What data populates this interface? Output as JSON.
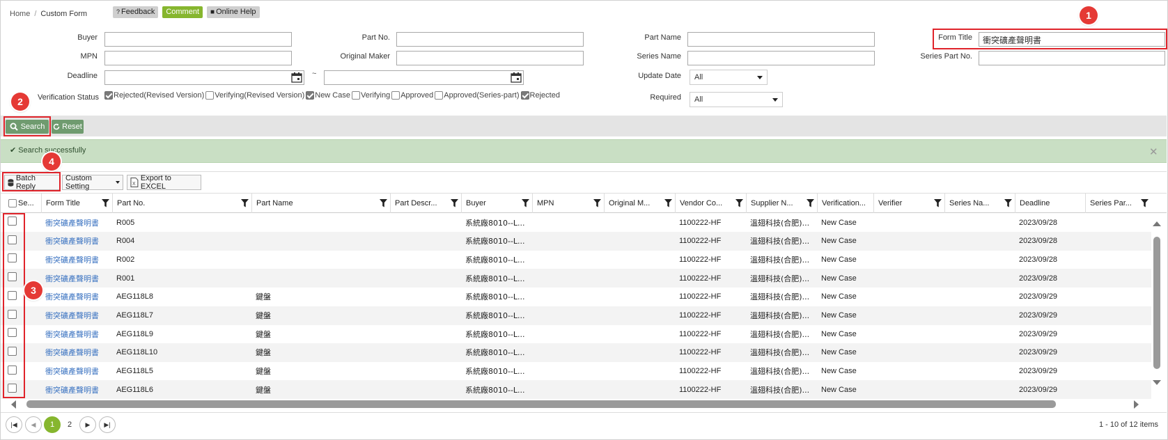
{
  "breadcrumb": {
    "home": "Home",
    "sep": "/",
    "current": "Custom Form"
  },
  "toplinks": {
    "feedback": "Feedback",
    "comment": "Comment",
    "online_help": "Online Help"
  },
  "form": {
    "buyer_label": "Buyer",
    "buyer_value": "",
    "part_no_label": "Part No.",
    "part_no_value": "",
    "part_name_label": "Part Name",
    "part_name_value": "",
    "form_title_label": "Form Title",
    "form_title_value": "衝突礦產聲明書",
    "mpn_label": "MPN",
    "mpn_value": "",
    "original_maker_label": "Original Maker",
    "original_maker_value": "",
    "series_name_label": "Series Name",
    "series_name_value": "",
    "series_part_no_label": "Series Part No.",
    "series_part_no_value": "",
    "deadline_label": "Deadline",
    "deadline_from": "",
    "deadline_to": "",
    "tilde": "~",
    "update_date_label": "Update Date",
    "update_date_value": "All",
    "required_label": "Required",
    "required_value": "All",
    "verification_status_label": "Verification Status",
    "verification_status": [
      {
        "label": "Rejected(Revised Version)",
        "checked": true
      },
      {
        "label": "Verifying(Revised Version)",
        "checked": false
      },
      {
        "label": "New Case",
        "checked": true
      },
      {
        "label": "Verifying",
        "checked": false
      },
      {
        "label": "Approved",
        "checked": false
      },
      {
        "label": "Approved(Series-part)",
        "checked": false
      },
      {
        "label": "Rejected",
        "checked": true
      }
    ]
  },
  "actions": {
    "search": "Search",
    "reset": "Reset"
  },
  "message": {
    "text": "Search successfully"
  },
  "grid_toolbar": {
    "batch_reply": "Batch Reply",
    "custom_setting": "Custom Setting",
    "export": "Export to EXCEL"
  },
  "columns": [
    "Se...",
    "Form Title",
    "Part No.",
    "Part Name",
    "Part Descr...",
    "Buyer",
    "MPN",
    "Original M...",
    "Vendor Co...",
    "Supplier N...",
    "Verification...",
    "Verifier",
    "Series Na...",
    "Deadline",
    "Series Par..."
  ],
  "rows": [
    {
      "form_title": "衝突礦產聲明書",
      "part_no": "R005",
      "part_name": "",
      "buyer": "系統廠8010--L...",
      "vendor_code": "1100222-HF",
      "supplier": "溫翅科技(合肥)...",
      "verification": "New Case",
      "deadline": "2023/09/28"
    },
    {
      "form_title": "衝突礦產聲明書",
      "part_no": "R004",
      "part_name": "",
      "buyer": "系統廠8010--L...",
      "vendor_code": "1100222-HF",
      "supplier": "溫翅科技(合肥)...",
      "verification": "New Case",
      "deadline": "2023/09/28"
    },
    {
      "form_title": "衝突礦產聲明書",
      "part_no": "R002",
      "part_name": "",
      "buyer": "系統廠8010--L...",
      "vendor_code": "1100222-HF",
      "supplier": "溫翅科技(合肥)...",
      "verification": "New Case",
      "deadline": "2023/09/28"
    },
    {
      "form_title": "衝突礦產聲明書",
      "part_no": "R001",
      "part_name": "",
      "buyer": "系統廠8010--L...",
      "vendor_code": "1100222-HF",
      "supplier": "溫翅科技(合肥)...",
      "verification": "New Case",
      "deadline": "2023/09/28"
    },
    {
      "form_title": "衝突礦產聲明書",
      "part_no": "AEG118L8",
      "part_name": "鍵盤",
      "buyer": "系統廠8010--L...",
      "vendor_code": "1100222-HF",
      "supplier": "溫翅科技(合肥)...",
      "verification": "New Case",
      "deadline": "2023/09/29"
    },
    {
      "form_title": "衝突礦產聲明書",
      "part_no": "AEG118L7",
      "part_name": "鍵盤",
      "buyer": "系統廠8010--L...",
      "vendor_code": "1100222-HF",
      "supplier": "溫翅科技(合肥)...",
      "verification": "New Case",
      "deadline": "2023/09/29"
    },
    {
      "form_title": "衝突礦產聲明書",
      "part_no": "AEG118L9",
      "part_name": "鍵盤",
      "buyer": "系統廠8010--L...",
      "vendor_code": "1100222-HF",
      "supplier": "溫翅科技(合肥)...",
      "verification": "New Case",
      "deadline": "2023/09/29"
    },
    {
      "form_title": "衝突礦產聲明書",
      "part_no": "AEG118L10",
      "part_name": "鍵盤",
      "buyer": "系統廠8010--L...",
      "vendor_code": "1100222-HF",
      "supplier": "溫翅科技(合肥)...",
      "verification": "New Case",
      "deadline": "2023/09/29"
    },
    {
      "form_title": "衝突礦產聲明書",
      "part_no": "AEG118L5",
      "part_name": "鍵盤",
      "buyer": "系統廠8010--L...",
      "vendor_code": "1100222-HF",
      "supplier": "溫翅科技(合肥)...",
      "verification": "New Case",
      "deadline": "2023/09/29"
    },
    {
      "form_title": "衝突礦產聲明書",
      "part_no": "AEG118L6",
      "part_name": "鍵盤",
      "buyer": "系統廠8010--L...",
      "vendor_code": "1100222-HF",
      "supplier": "溫翅科技(合肥)...",
      "verification": "New Case",
      "deadline": "2023/09/29"
    }
  ],
  "pager": {
    "pages": [
      "1",
      "2"
    ],
    "current": "1",
    "info": "1 - 10 of 12 items"
  },
  "annotations": [
    "1",
    "2",
    "3",
    "4"
  ],
  "colors": {
    "accent_green": "#86b62e",
    "button_green": "#6f9b6f",
    "highlight_red": "#e0232a",
    "link_blue": "#3b73c1"
  }
}
